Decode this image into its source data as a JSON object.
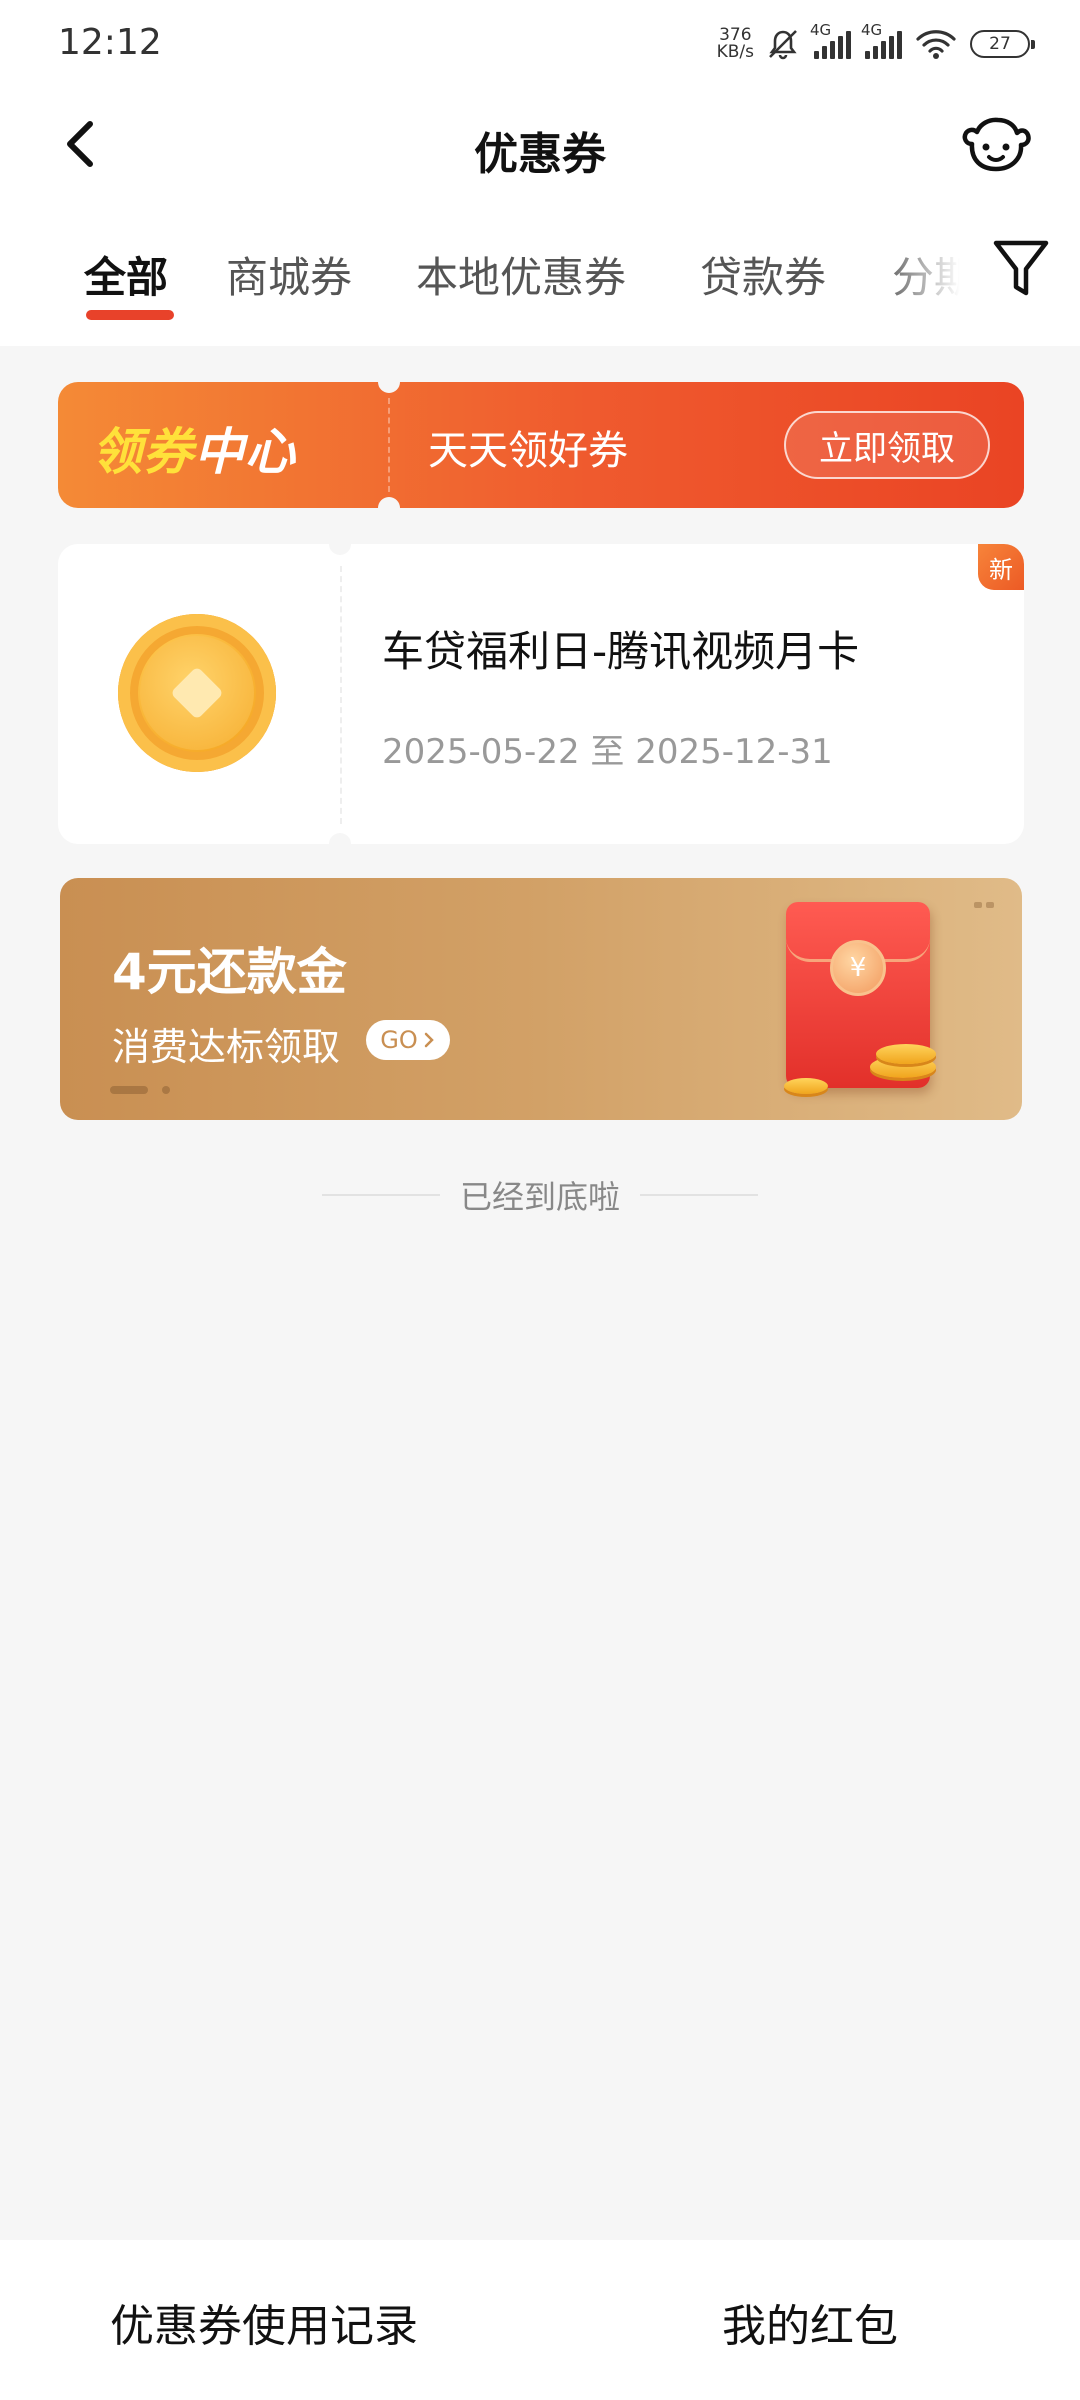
{
  "status_bar": {
    "time": "12:12",
    "net_speed_value": "376",
    "net_speed_unit": "KB/s",
    "signal1_label": "4G",
    "signal2_label": "4G",
    "battery": "27"
  },
  "header": {
    "title": "优惠券",
    "back_icon": "chevron-left-icon",
    "service_icon": "customer-service-icon"
  },
  "tabs": {
    "items": [
      {
        "label": "全部",
        "active": true
      },
      {
        "label": "商城券",
        "active": false
      },
      {
        "label": "本地优惠券",
        "active": false
      },
      {
        "label": "贷款券",
        "active": false
      },
      {
        "label": "分期",
        "active": false
      }
    ],
    "filter_icon": "filter-icon",
    "accent_color": "#e8422a"
  },
  "coupon_center": {
    "title_part1": "领券",
    "title_part2": "中心",
    "subtitle": "天天领好券",
    "button_label": "立即领取"
  },
  "coupons": [
    {
      "name": "车贷福利日-腾讯视频月卡",
      "date_range": "2025-05-22 至 2025-12-31",
      "badge": "新",
      "icon": "gold-coin-icon"
    }
  ],
  "banner": {
    "title": "4元还款金",
    "subtitle": "消费达标领取",
    "go_label": "GO",
    "envelope_symbol": "¥"
  },
  "end_note": "已经到底啦",
  "bottom_bar": {
    "left_label": "优惠券使用记录",
    "right_label": "我的红包"
  }
}
